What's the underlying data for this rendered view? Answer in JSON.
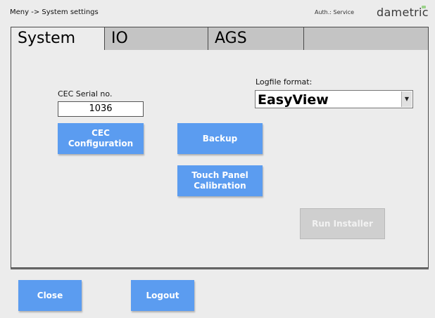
{
  "header": {
    "breadcrumb": "Meny -> System settings",
    "auth": "Auth.: Service",
    "logo": "dametric"
  },
  "tabs": [
    {
      "label": "System",
      "active": true
    },
    {
      "label": "IO",
      "active": false
    },
    {
      "label": "AGS",
      "active": false
    },
    {
      "label": "",
      "active": false
    }
  ],
  "panel": {
    "serial_label": "CEC Serial no.",
    "serial_value": "1036",
    "logfile_label": "Logfile format:",
    "logfile_value": "EasyView",
    "cec_config_label": "CEC\nConfiguration",
    "backup_label": "Backup",
    "touch_calibration_label": "Touch Panel\nCalibration",
    "run_installer_label": "Run Installer"
  },
  "footer": {
    "close_label": "Close",
    "logout_label": "Logout"
  },
  "colors": {
    "button_blue": "#5b9cf0",
    "disabled_gray": "#cfcfcf",
    "logo_accent": "#9bd28a"
  },
  "icons": {
    "dropdown_arrow": "chevron-down-icon"
  }
}
